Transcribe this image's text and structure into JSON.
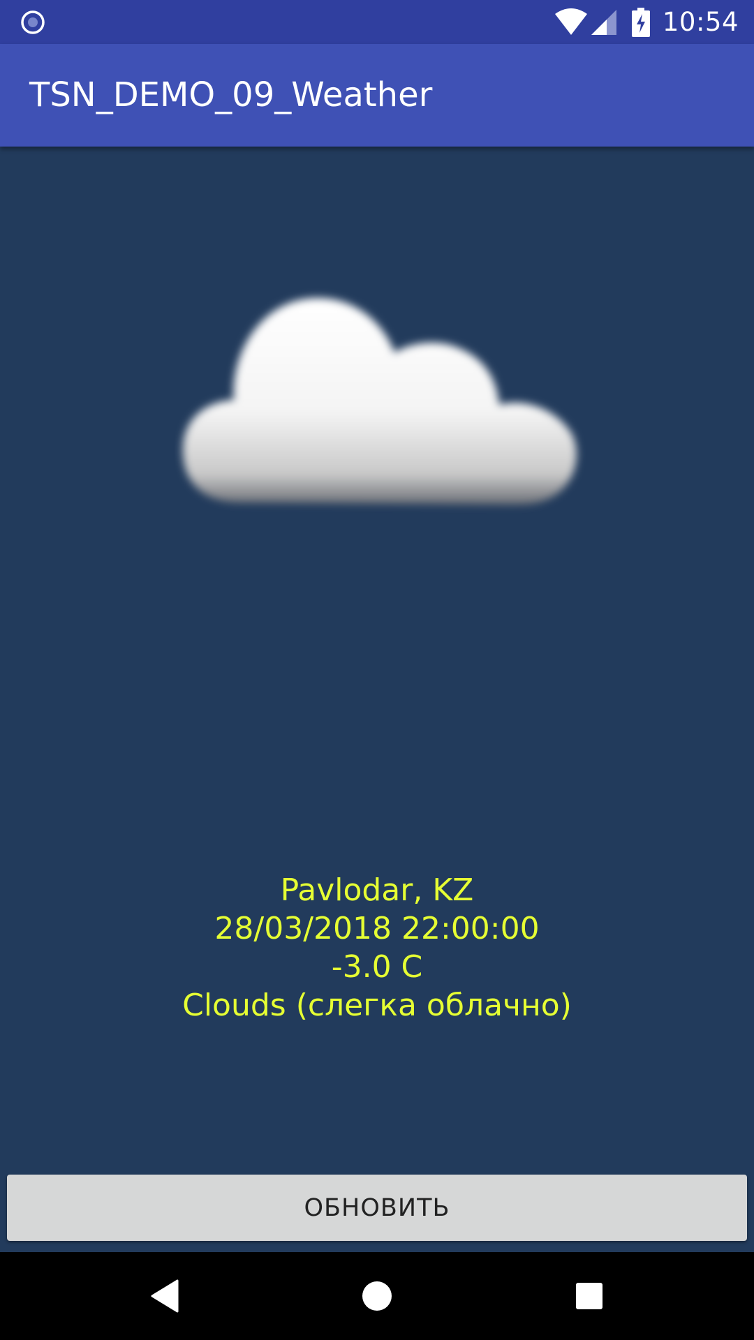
{
  "status_bar": {
    "time": "10:54",
    "icons": [
      "notification-circle-icon",
      "wifi-icon",
      "cell-signal-icon",
      "battery-charging-icon"
    ]
  },
  "app_bar": {
    "title": "TSN_DEMO_09_Weather"
  },
  "weather": {
    "icon": "cloud-icon",
    "location": "Pavlodar, KZ",
    "datetime": "28/03/2018 22:00:00",
    "temperature": "-3.0 C",
    "description": "Clouds (слегка облачно)"
  },
  "refresh_button": {
    "label": "ОБНОВИТЬ"
  },
  "nav_bar": {
    "icons": [
      "back-icon",
      "home-icon",
      "recents-icon"
    ]
  },
  "colors": {
    "status_bar": "#303f9f",
    "app_bar": "#3f51b5",
    "background": "#223b5c",
    "info_text": "#e6ff33",
    "button": "#d6d7d7"
  }
}
